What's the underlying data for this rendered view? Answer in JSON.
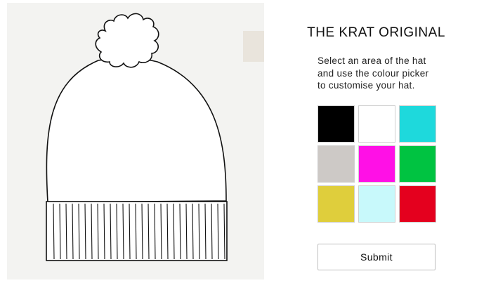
{
  "header": {
    "title": "THE KRAT ORIGINAL"
  },
  "instructions": {
    "lines": [
      "Select an area of the hat",
      "and use the colour picker",
      "to customise your hat."
    ]
  },
  "palette": {
    "colors": [
      "#000000",
      "#ffffff",
      "#1ed9dc",
      "#cdc9c6",
      "#ff10e6",
      "#00c341",
      "#dfce3c",
      "#c8f9fb",
      "#e4001e"
    ],
    "color_names": [
      "black",
      "white",
      "cyan",
      "grey",
      "magenta",
      "green",
      "yellow",
      "light-cyan",
      "red"
    ]
  },
  "actions": {
    "submit_label": "Submit"
  },
  "hat": {
    "pompom_color": "#ffffff",
    "crown_color": "#ffffff",
    "brim_color": "#ffffff",
    "line_color": "#111111"
  }
}
